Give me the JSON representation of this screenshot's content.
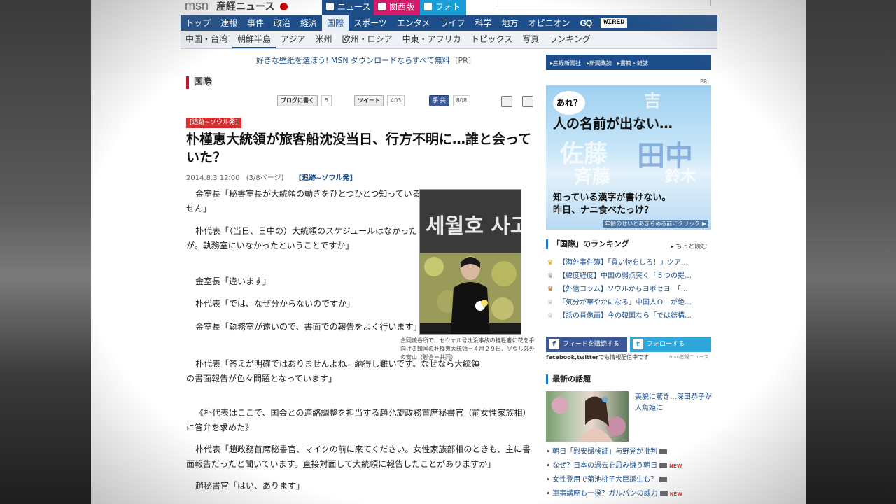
{
  "header": {
    "logo_msn": "msn",
    "logo_brand": "産経ニュース",
    "service_tabs": [
      {
        "label": "ニュース",
        "color": "#1d4e89"
      },
      {
        "label": "関西版",
        "color": "#d61a6b"
      },
      {
        "label": "フォト",
        "color": "#1a9ed6"
      }
    ]
  },
  "nav_main": [
    "トップ",
    "速報",
    "事件",
    "政治",
    "経済",
    "国際",
    "スポーツ",
    "エンタメ",
    "ライフ",
    "科学",
    "地方",
    "オピニオン",
    "GQ",
    "WIRED"
  ],
  "nav_main_active": "国際",
  "nav_sub": [
    "中国・台湾",
    "朝鮮半島",
    "アジア",
    "米州",
    "欧州・ロシア",
    "中東・アフリカ",
    "トピックス",
    "写真",
    "ランキング"
  ],
  "nav_sub_active": "朝鮮半島",
  "ad_line": {
    "text": "好きな壁紙を選ぼう! MSN ダウンロードならすべて無料",
    "pr": "[PR]"
  },
  "section_title": "国際",
  "social": {
    "blog_label": "ブログに書く",
    "blog_count": "5",
    "tweet_label": "ツイート",
    "tweet_count": "403",
    "fb_label": "手 共",
    "fb_count": "808"
  },
  "article": {
    "kicker": "[追跡~ソウル発]",
    "headline": "朴槿恵大統領が旅客船沈没当日、行方不明に…誰と会っていた？",
    "date": "2014.8.3 12:00",
    "page": "(3/8ページ)",
    "tag": "[追跡~ソウル発]",
    "paragraphs": [
      "金室長「秘書室長が大統領の動きをひとつひとつ知っているわけではありません」",
      "朴代表「（当日、日中の）大統領のスケジュールはなかったと聞いていますが。執務室にいなかったということですか」",
      "金室長「違います」",
      "朴代表「では、なぜ分からないのですか」",
      "金室長「執務室が遠いので、書面での報告をよく行います」",
      "朴代表「答えが明確ではありませんよね。納得し難いです。なぜなら大統領の書面報告が色々問題となっています」",
      "《朴代表はここで、国会との連絡調整を担当する趙允旋政務首席秘書官（前女性家族相）に答弁を求めた》",
      "朴代表「趙政務首席秘書官、マイクの前に来てください。女性家族部相のときも、主に書面報告だったと聞いています。直接対面して大統領に報告したことがありますか」",
      "趙秘書官「はい、あります」"
    ],
    "photo_banner": "세월호 사고 희",
    "caption": "合同焼香所で、セウォル号沈没事故の犠牲者に花を手向ける韓国の朴槿恵大統領＝４月２９日、ソウル郊外の安山（聯合＝共同）"
  },
  "sidebar": {
    "bar_links": "▸産経新聞社　▸新聞購読　▸書籍・雑誌",
    "pr": "PR",
    "ad": {
      "bubble": "あれ？",
      "line1": "人の名前が出ない…",
      "kanji": [
        "吉",
        "佐藤",
        "田中",
        "斉藤",
        "鈴木"
      ],
      "line2": "知っている漢字が書けない。",
      "line3": "昨日、ナニ食べたっけ？",
      "footer": "年齢のせいとあきらめる前にクリック ▶"
    },
    "ranking_title": "「国際」のランキング",
    "ranking_more": "▸ もっと読む",
    "ranking": [
      {
        "medal": "♛",
        "color": "#e0a800",
        "text": "【海外事件簿】「買い物をしろ！」ツア…"
      },
      {
        "medal": "♛",
        "color": "#999999",
        "text": "【緯度経度】中国の弱点突く「５つの提…"
      },
      {
        "medal": "♛",
        "color": "#b06a2b",
        "text": "【外信コラム】ソウルからヨボセヨ　「…"
      },
      {
        "medal": "♕",
        "color": "#999999",
        "text": "「気分が華やかになる」中国人ＯＬが絶…"
      },
      {
        "medal": "♕",
        "color": "#999999",
        "text": "【話の肖像画】今の韓国なら「では結構…"
      }
    ],
    "follow_fb": "フィードを購読する",
    "follow_tw": "フォローする",
    "follow_note_bold": "facebook,twitter",
    "follow_note": "でも情報配信中です",
    "follow_msn": "msn産経ニュース",
    "latest_title": "最新の話題",
    "latest_thumb_text": "美貌に驚き…深田恭子が人魚姫に",
    "latest": [
      {
        "text": "朝日「慰安婦検証」与野党が批判",
        "cam": true,
        "new": false
      },
      {
        "text": "なぜ？日本の過去を忌み嫌う朝日",
        "cam": true,
        "new": true
      },
      {
        "text": "女性登用で菊池桃子大臣誕生も？",
        "cam": true,
        "new": false
      },
      {
        "text": "軍事講座も一揆？ガルパンの威力",
        "cam": true,
        "new": true
      }
    ],
    "new_label": "NEW"
  }
}
